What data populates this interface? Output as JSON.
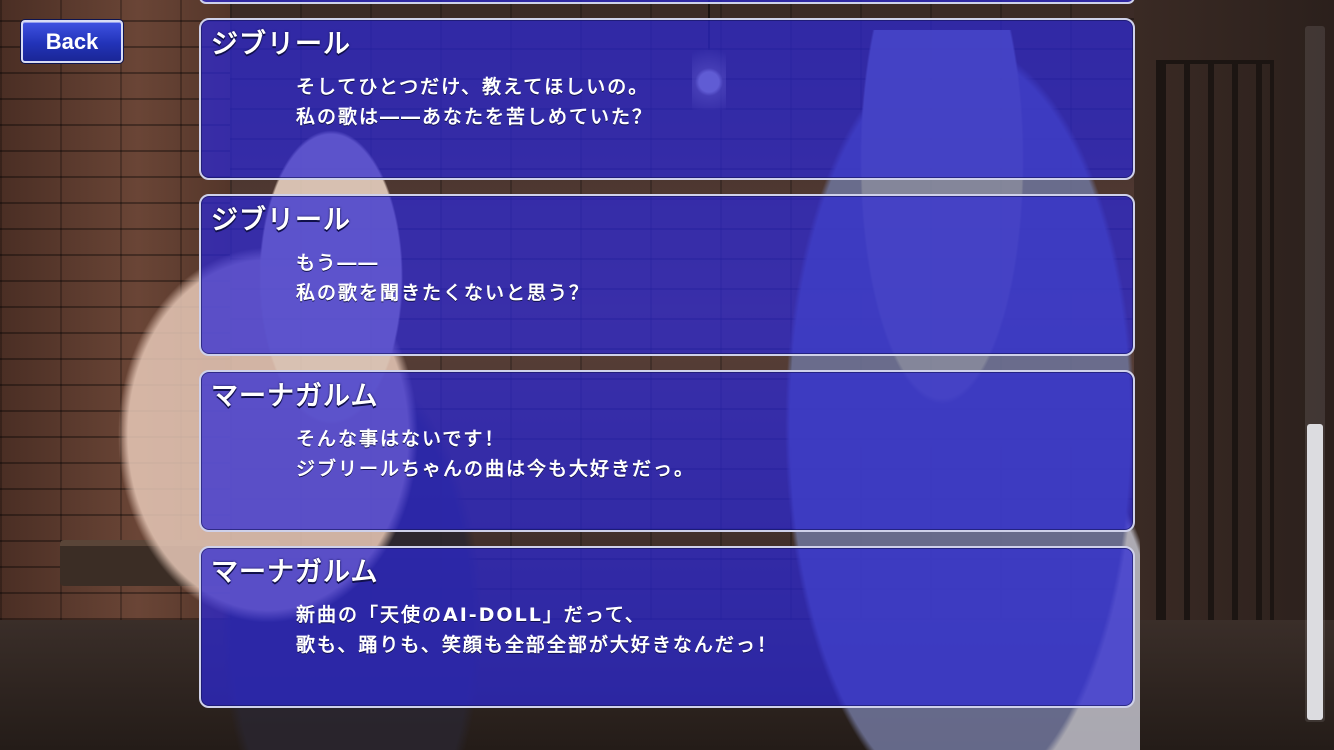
{
  "back_button": {
    "label": "Back"
  },
  "log_entries": [
    {
      "speaker": "ジブリール",
      "lines": [
        "そしてひとつだけ、教えてほしいの。",
        "私の歌は――あなたを苦しめていた？"
      ]
    },
    {
      "speaker": "ジブリール",
      "lines": [
        "もう――",
        "私の歌を聞きたくないと思う？"
      ]
    },
    {
      "speaker": "マーナガルム",
      "lines": [
        "そんな事はないです！",
        "ジブリールちゃんの曲は今も大好きだっ。"
      ]
    },
    {
      "speaker": "マーナガルム",
      "lines": [
        "新曲の「天使のAI-DOLL」だって、",
        "歌も、踊りも、笑顔も全部全部が大好きなんだっ！"
      ]
    }
  ],
  "scrollbar": {
    "position_fraction": 0.57
  },
  "colors": {
    "panel_fill": "#2c28d6",
    "panel_border": "#cfd1ea",
    "button_fill": "#2233b8",
    "text": "#ffffff"
  }
}
